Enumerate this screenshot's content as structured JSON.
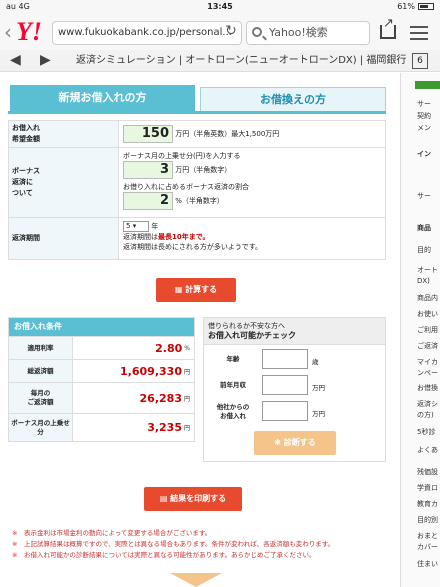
{
  "status": {
    "carrier": "au 4G",
    "time": "13:45",
    "battery": "61%"
  },
  "browser": {
    "url": "www.fukuokabank.co.jp/personal...",
    "search_placeholder": "Yahoo!検索",
    "yahoo": "Y!",
    "tabs_count": "6",
    "page_title": "返済シミュレーション | オートローン(ニューオートローンDX) | 福岡銀行"
  },
  "tabs": {
    "new": "新規お借入れの方",
    "refinance": "お借換えの方"
  },
  "form": {
    "amount_label": "お借入れ\n希望金額",
    "amount_value": "150",
    "amount_unit": "万円（半角英数）最大1,500万円",
    "bonus_label": "ボーナス\n返済に\nついて",
    "bonus_desc1": "ボーナス月の上乗せ分(円)を入力する",
    "bonus_value1": "3",
    "bonus_unit1": "万円（半角数字）",
    "bonus_desc2": "お借り入れに占めるボーナス返済の割合",
    "bonus_value2": "2",
    "bonus_unit2": "%（半角数字）",
    "period_label": "返済期間",
    "period_value": "5",
    "period_unit": "年",
    "period_note1_pre": "返済期間は",
    "period_note1_red": "最長10年まで。",
    "period_note2": "返済期間は長めにされる方が多いようです。"
  },
  "calc_button": "計算する",
  "results": {
    "header": "お借入れ条件",
    "rows": [
      {
        "label": "適用利率",
        "value": "2.80",
        "unit": "%"
      },
      {
        "label": "総返済額",
        "value": "1,609,330",
        "unit": "円"
      },
      {
        "label": "毎月の\nご返済額",
        "value": "26,283",
        "unit": "円"
      },
      {
        "label": "ボーナス月の上乗せ分",
        "value": "3,235",
        "unit": "円"
      }
    ]
  },
  "check": {
    "sub": "借りられるか不安な方へ",
    "title": "お借入れ可能かチェック",
    "age_label": "年齢",
    "age_unit": "歳",
    "income_label": "前年月収",
    "income_unit": "万円",
    "other_label": "他社からの\nお借入れ",
    "other_unit": "万円",
    "diagnose": "診断する"
  },
  "print_button": "結果を印刷する",
  "notes": [
    "※　表示金利は市場金利の動向によって変更する場合がございます。",
    "※　上記試算結果は概算ですので、実際とは異なる場合もあります。条件が変われば、各返済額も変わります。",
    "※　お借入れ可能かの診断結果については実際と異なる可能性があります。あらかじめご了承ください。"
  ],
  "sidebar": {
    "items": [
      "サー",
      "契約",
      "メン",
      "イン",
      "サー",
      "商品",
      "目的",
      "オート",
      "DX)",
      "商品内",
      "お使い",
      "ご利用",
      "ご返済",
      "マイカ",
      "ンペー",
      "お借換",
      "返済シ",
      "の方)",
      "5秒診",
      "よくあ",
      "残価設",
      "学資ロ",
      "教育カ",
      "目的別",
      "おまと",
      "カバー",
      "住まい"
    ]
  }
}
